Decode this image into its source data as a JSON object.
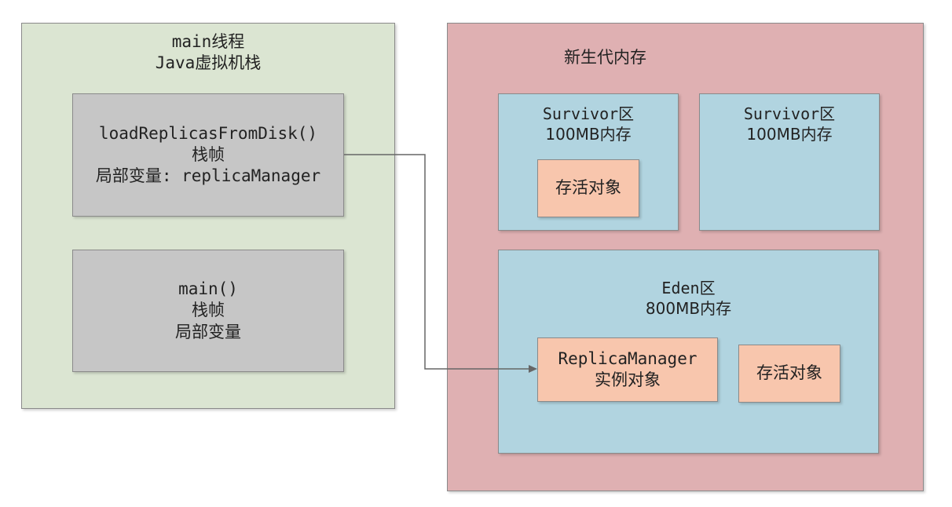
{
  "stack": {
    "title_line1": "main线程",
    "title_line2": "Java虚拟机栈",
    "frames": [
      {
        "line1": "loadReplicasFromDisk()",
        "line2": "栈帧",
        "line3": "局部变量: replicaManager"
      },
      {
        "line1": "main()",
        "line2": "栈帧",
        "line3": "局部变量"
      }
    ]
  },
  "heap": {
    "title": "新生代内存",
    "survivors": [
      {
        "name": "Survivor区",
        "size": "100MB内存",
        "object": "存活对象"
      },
      {
        "name": "Survivor区",
        "size": "100MB内存"
      }
    ],
    "eden": {
      "name": "Eden区",
      "size": "800MB内存",
      "objects": [
        {
          "line1": "ReplicaManager",
          "line2": "实例对象"
        },
        {
          "line1": "存活对象"
        }
      ]
    }
  },
  "colors": {
    "stack_bg": "#dbe5d2",
    "frame_bg": "#c6c6c6",
    "heap_bg": "#dfb0b2",
    "region_bg": "#b1d4e0",
    "object_bg": "#f8c6ad",
    "arrow": "#666666"
  }
}
